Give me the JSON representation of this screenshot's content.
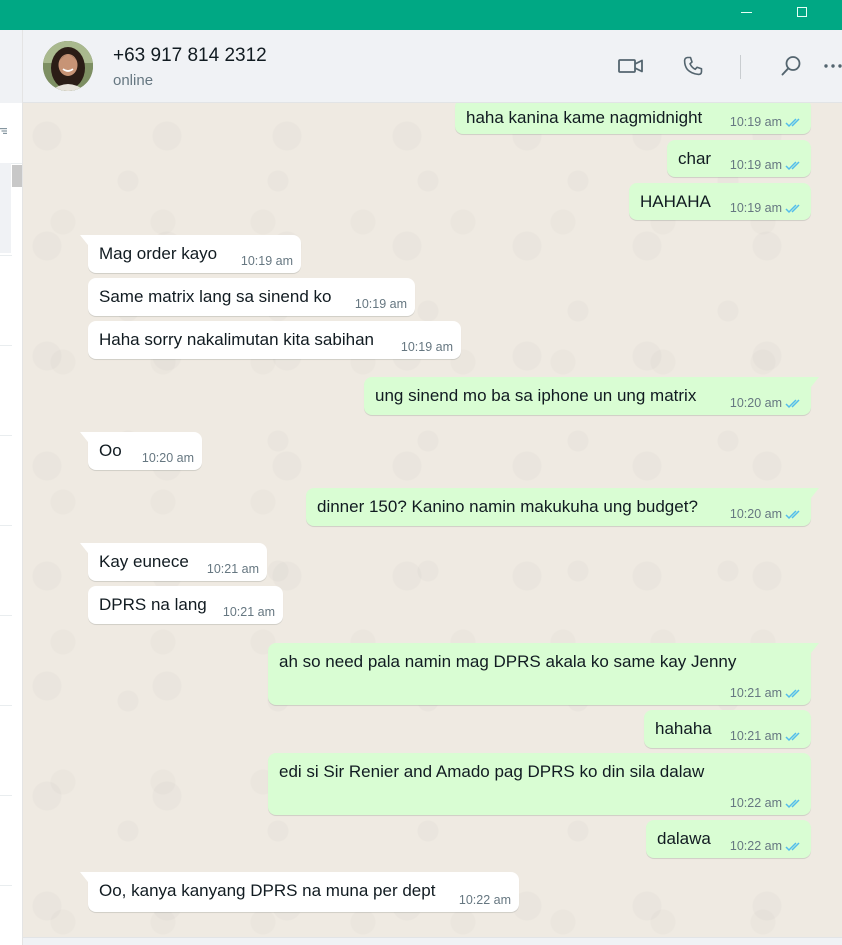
{
  "header": {
    "contact_name": "+63 917 814 2312",
    "status": "online"
  },
  "icons": {
    "video": "video-camera-icon",
    "call": "phone-icon",
    "search": "search-icon",
    "menu": "more-options-icon"
  },
  "colors": {
    "brand": "#00a884",
    "incoming_bubble": "#ffffff",
    "outgoing_bubble": "#d9fdd3",
    "read_ticks": "#53bdeb",
    "chat_background": "#efeae2"
  },
  "messages": [
    {
      "dir": "out",
      "text": "haha kanina kame nagmidnight",
      "time": "10:19 am",
      "status": "read"
    },
    {
      "dir": "out",
      "text": "char",
      "time": "10:19 am",
      "status": "read"
    },
    {
      "dir": "out",
      "text": "HAHAHA",
      "time": "10:19 am",
      "status": "read"
    },
    {
      "dir": "in",
      "text": "Mag order kayo",
      "time": "10:19 am"
    },
    {
      "dir": "in",
      "text": "Same matrix lang sa sinend ko",
      "time": "10:19 am"
    },
    {
      "dir": "in",
      "text": "Haha sorry nakalimutan kita sabihan",
      "time": "10:19 am"
    },
    {
      "dir": "out",
      "text": "ung sinend mo ba sa iphone un ung matrix",
      "time": "10:20 am",
      "status": "read"
    },
    {
      "dir": "in",
      "text": "Oo",
      "time": "10:20 am"
    },
    {
      "dir": "out",
      "text": "dinner 150? Kanino namin makukuha ung budget?",
      "time": "10:20 am",
      "status": "read"
    },
    {
      "dir": "in",
      "text": "Kay eunece",
      "time": "10:21 am"
    },
    {
      "dir": "in",
      "text": "DPRS na lang",
      "time": "10:21 am"
    },
    {
      "dir": "out",
      "text": "ah so need pala namin mag DPRS akala ko same kay Jenny",
      "time": "10:21 am",
      "status": "read"
    },
    {
      "dir": "out",
      "text": "hahaha",
      "time": "10:21 am",
      "status": "read"
    },
    {
      "dir": "out",
      "text": "edi si Sir Renier and Amado pag DPRS ko din sila dalaw",
      "time": "10:22 am",
      "status": "read"
    },
    {
      "dir": "out",
      "text": "dalawa",
      "time": "10:22 am",
      "status": "read"
    },
    {
      "dir": "in",
      "text": "Oo, kanya kanyang DPRS na muna per dept",
      "time": "10:22 am"
    }
  ]
}
